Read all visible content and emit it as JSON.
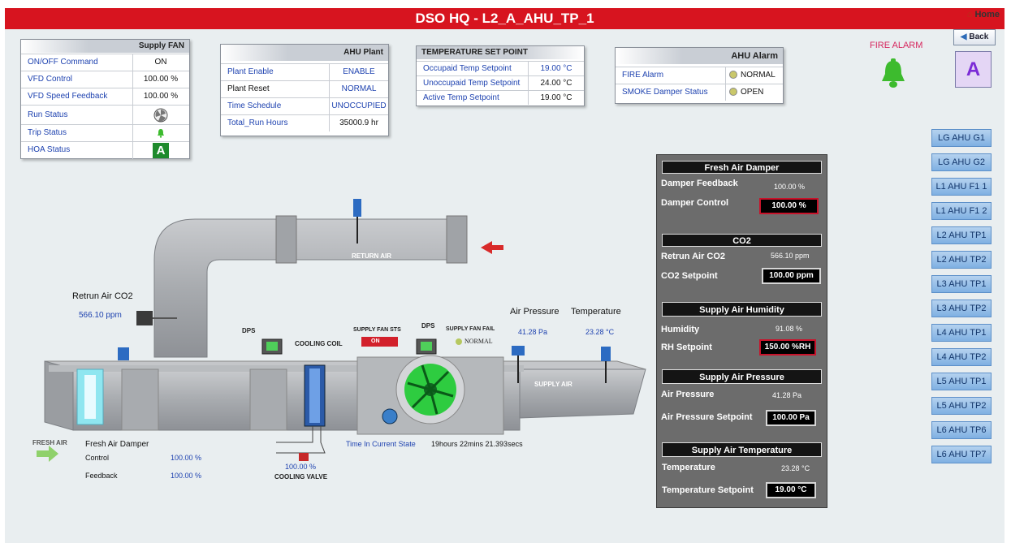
{
  "title": "DSO HQ - L2_A_AHU_TP_1",
  "home_label": "Home",
  "back_label": "Back",
  "supply_fan": {
    "header": "Supply FAN",
    "rows": [
      {
        "label": "ON/OFF Command",
        "value": "ON"
      },
      {
        "label": "VFD Control",
        "value": "100.00 %"
      },
      {
        "label": "VFD Speed Feedback",
        "value": "100.00 %"
      },
      {
        "label": "Run Status",
        "icon": "fan-icon"
      },
      {
        "label": "Trip Status",
        "icon": "bell-icon"
      },
      {
        "label": "HOA Status",
        "icon": "auto-a-icon",
        "hoa": "A"
      }
    ]
  },
  "ahu_plant": {
    "header": "AHU Plant",
    "rows": [
      {
        "label": "Plant Enable",
        "value": "ENABLE"
      },
      {
        "label": "Plant Reset",
        "value": "NORMAL"
      },
      {
        "label": "Time Schedule",
        "value": "UNOCCUPIED"
      },
      {
        "label": "Total_Run Hours",
        "value": "35000.9 hr"
      }
    ]
  },
  "temp_setpoint": {
    "header": "TEMPERATURE SET POINT",
    "rows": [
      {
        "label": "Occupaid Temp Setpoint",
        "value": "19.00 °C"
      },
      {
        "label": "Unoccupaid Temp Setpoint",
        "value": "24.00 °C"
      },
      {
        "label": "Active Temp Setpoint",
        "value": "19.00 °C"
      }
    ]
  },
  "ahu_alarm": {
    "header": "AHU Alarm",
    "rows": [
      {
        "label": "FIRE Alarm",
        "value": "NORMAL"
      },
      {
        "label": "SMOKE Damper Status",
        "value": "OPEN"
      }
    ]
  },
  "fire_alarm_label": "FIRE ALARM",
  "mode_badge": "A",
  "diagram": {
    "return_air": "RETURN AIR",
    "supply_air": "SUPPLY AIR",
    "fresh_air": "FRESH AIR",
    "retrun_co2_title": "Retrun Air CO2",
    "retrun_co2_value": "566.10 ppm",
    "dps1": "DPS",
    "dps2": "DPS",
    "cooling_coil": "COOLING COIL",
    "supply_fan_sts": "SUPPLY FAN STS",
    "supply_fan_sts_value": "ON",
    "supply_fan_fail": "SUPPLY FAN FAIL",
    "supply_fan_fail_value": "NORMAL",
    "air_pressure_title": "Air Pressure",
    "air_pressure_value": "41.28 Pa",
    "temperature_title": "Temperature",
    "temperature_value": "23.28 °C",
    "cooling_valve_value": "100.00 %",
    "cooling_valve_label": "COOLING VALVE",
    "time_state_label": "Time In Current State",
    "time_state_value": "19hours 22mins 21.393secs",
    "fresh_damper_title": "Fresh Air Damper",
    "fresh_control_label": "Control",
    "fresh_control_value": "100.00 %",
    "fresh_feedback_label": "Feedback",
    "fresh_feedback_value": "100.00 %"
  },
  "dark_panel": {
    "fresh_air_damper": {
      "header": "Fresh Air Damper",
      "feedback_label": "Damper Feedback",
      "feedback_value": "100.00 %",
      "control_label": "Damper Control",
      "control_value": "100.00 %"
    },
    "co2": {
      "header": "CO2",
      "retrun_label": "Retrun Air CO2",
      "retrun_value": "566.10 ppm",
      "setpoint_label": "CO2 Setpoint",
      "setpoint_value": "100.00 ppm"
    },
    "humidity": {
      "header": "Supply Air Humidity",
      "label": "Humidity",
      "value": "91.08 %",
      "setpoint_label": "RH Setpoint",
      "setpoint_value": "150.00 %RH"
    },
    "pressure": {
      "header": "Supply Air Pressure",
      "label": "Air Pressure",
      "value": "41.28 Pa",
      "setpoint_label": "Air Pressure Setpoint",
      "setpoint_value": "100.00 Pa"
    },
    "temperature": {
      "header": "Supply Air Temperature",
      "label": "Temperature",
      "value": "23.28 °C",
      "setpoint_label": "Temperature Setpoint",
      "setpoint_value": "19.00 °C"
    }
  },
  "nav": [
    "LG AHU G1",
    "LG AHU G2",
    "L1 AHU F1 1",
    "L1 AHU F1 2",
    "L2 AHU TP1",
    "L2 AHU TP2",
    "L3 AHU TP1",
    "L3 AHU TP2",
    "L4 AHU TP1",
    "L4 AHU TP2",
    "L5 AHU TP1",
    "L5 AHU TP2",
    "L6 AHU TP6",
    "L6 AHU TP7"
  ],
  "colors": {
    "title_bar": "#d7141f",
    "label_blue": "#1f43b0",
    "nav_blue": "#7fb0e2",
    "alarm_green": "#3dbb2e"
  }
}
